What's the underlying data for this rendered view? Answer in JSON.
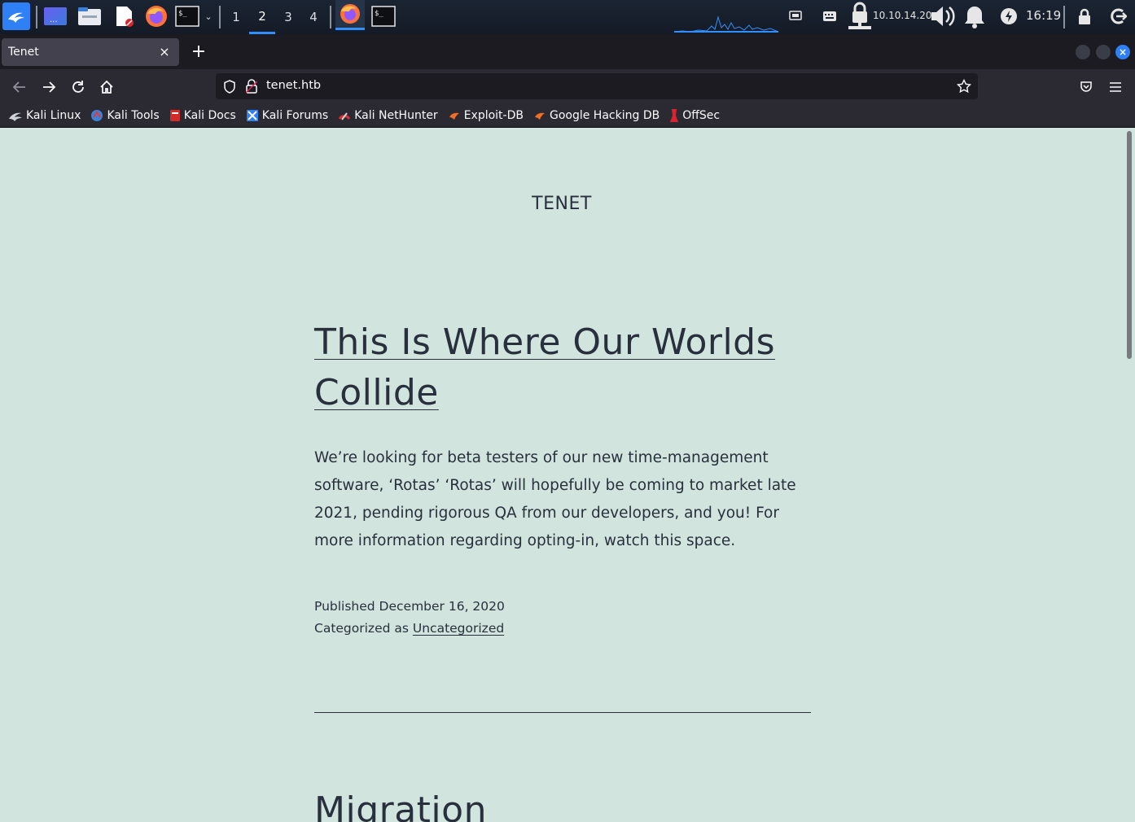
{
  "panel": {
    "workspaces": [
      "1",
      "2",
      "3",
      "4"
    ],
    "active_workspace": "2",
    "ip_address": "10.10.14.20",
    "clock": "16:19",
    "icons": [
      "kali-menu-icon",
      "desktop-icon",
      "file-manager-icon",
      "text-editor-icon",
      "firefox-icon",
      "terminal-icon",
      "firefox-task-icon",
      "terminal-task-icon",
      "network-icon",
      "keyboard-icon",
      "vpn-lock-icon",
      "volume-icon",
      "notification-bell-icon",
      "power-icon",
      "lock-screen-icon",
      "logout-icon"
    ]
  },
  "browser": {
    "tab_title": "Tenet",
    "tab_close": "×",
    "new_tab": "+",
    "url": "tenet.htb",
    "bookmarks": [
      {
        "label": "Kali Linux",
        "icon": "kali-dragon-icon"
      },
      {
        "label": "Kali Tools",
        "icon": "kali-tools-icon"
      },
      {
        "label": "Kali Docs",
        "icon": "kali-docs-icon"
      },
      {
        "label": "Kali Forums",
        "icon": "kali-forums-icon"
      },
      {
        "label": "Kali NetHunter",
        "icon": "nethunter-icon"
      },
      {
        "label": "Exploit-DB",
        "icon": "exploit-db-icon"
      },
      {
        "label": "Google Hacking DB",
        "icon": "ghdb-icon"
      },
      {
        "label": "OffSec",
        "icon": "offsec-icon"
      }
    ]
  },
  "page": {
    "site_title": "TENET",
    "post": {
      "title_line1": "This Is Where Our Worlds",
      "title_line2": "Collide",
      "body": "We’re looking for beta testers of our new time-management software, ‘Rotas’ ‘Rotas’ will hopefully be coming to market late 2021, pending rigorous QA from our developers, and you! For more information regarding opting-in, watch this space.",
      "published": "Published December 16, 2020",
      "categorized_prefix": "Categorized as ",
      "category": "Uncategorized"
    },
    "next_post_title": "Migration"
  },
  "colors": {
    "page_bg": "#d1e4dd",
    "text": "#28303d",
    "browser_chrome": "#2b2a33",
    "accent": "#2f8fff"
  }
}
